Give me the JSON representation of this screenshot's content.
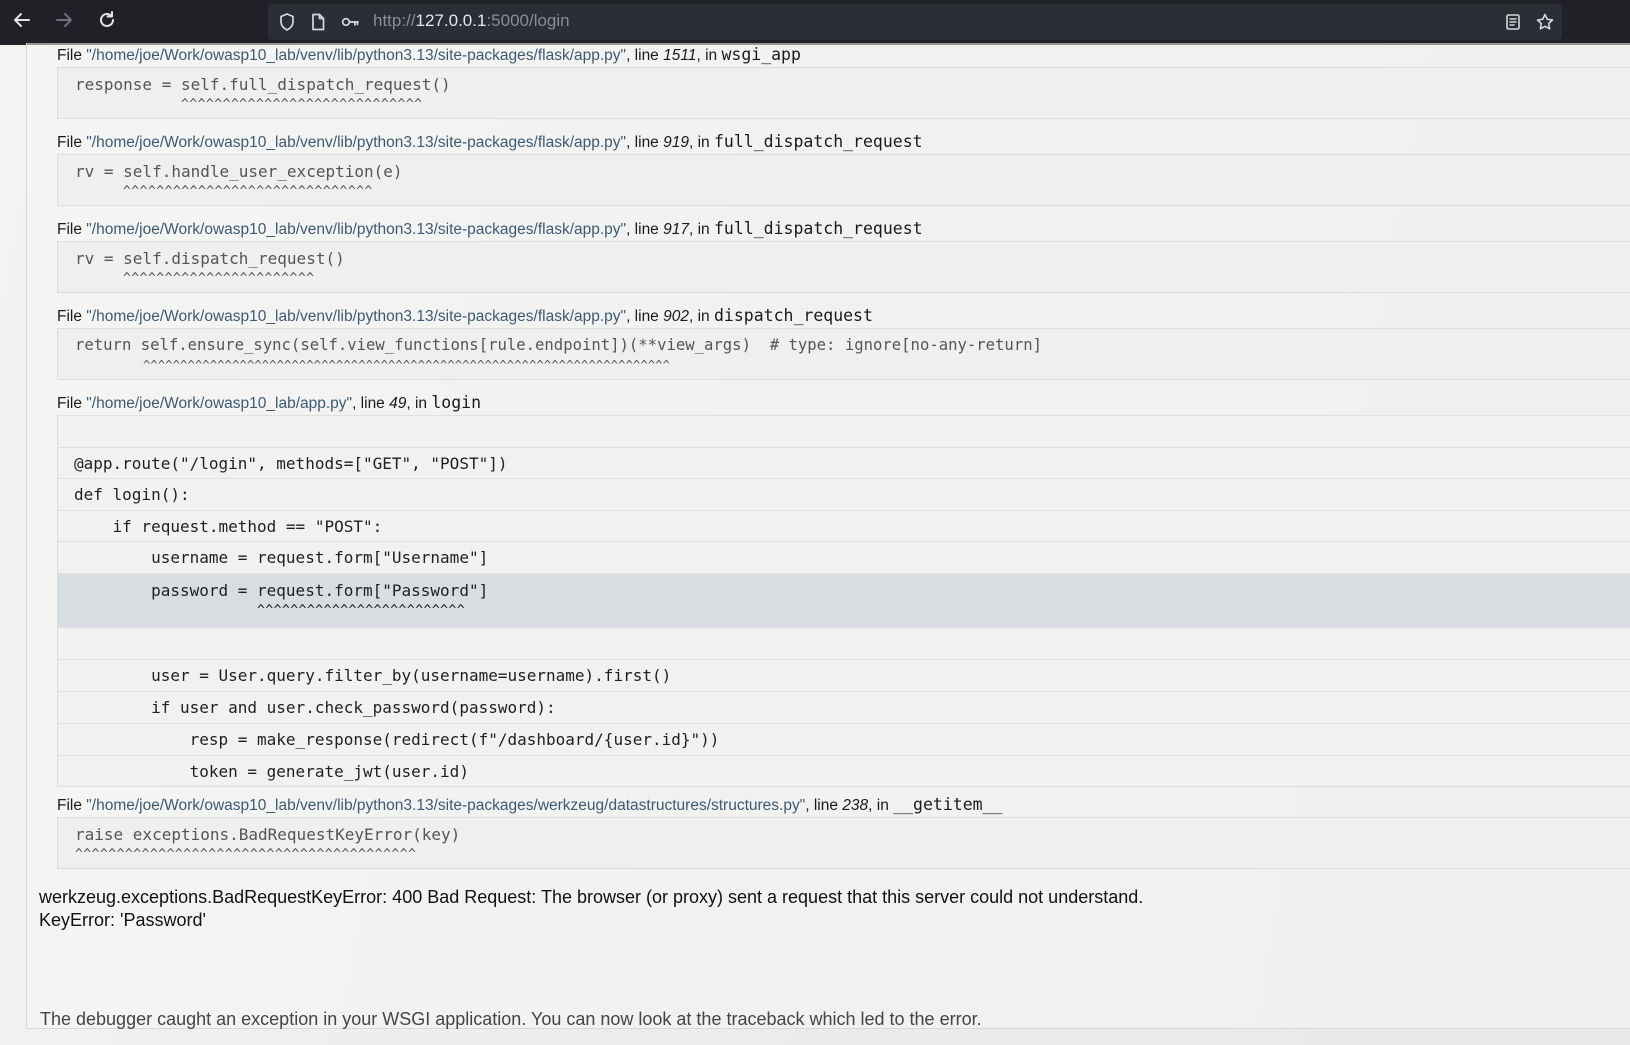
{
  "browser": {
    "url_prefix": "http://",
    "url_host": "127.0.0.1",
    "url_suffix": ":5000/login",
    "icons": [
      "back-arrow-icon",
      "forward-arrow-icon",
      "reload-icon",
      "shield-icon",
      "page-icon",
      "key-icon",
      "reader-view-icon",
      "bookmark-star-icon"
    ]
  },
  "frames": [
    {
      "file_prefix": "File ",
      "path": "\"/home/joe/Work/owasp10_lab/venv/lib/python3.13/site-packages/flask/app.py\"",
      "line_label": ", line ",
      "line": "1511",
      "in_label": ", in ",
      "function": "wsgi_app",
      "code": "response = self.full_dispatch_request()",
      "carets": "^^^^^^^^^^^^^^^^^^^^^^^^^^^^^"
    },
    {
      "file_prefix": "File ",
      "path": "\"/home/joe/Work/owasp10_lab/venv/lib/python3.13/site-packages/flask/app.py\"",
      "line_label": ", line ",
      "line": "919",
      "in_label": ", in ",
      "function": "full_dispatch_request",
      "code": "rv = self.handle_user_exception(e)",
      "carets": "^^^^^^^^^^^^^^^^^^^^^^^^^^^^^^"
    },
    {
      "file_prefix": "File ",
      "path": "\"/home/joe/Work/owasp10_lab/venv/lib/python3.13/site-packages/flask/app.py\"",
      "line_label": ", line ",
      "line": "917",
      "in_label": ", in ",
      "function": "full_dispatch_request",
      "code": "rv = self.dispatch_request()",
      "carets": "^^^^^^^^^^^^^^^^^^^^^^^"
    },
    {
      "file_prefix": "File ",
      "path": "\"/home/joe/Work/owasp10_lab/venv/lib/python3.13/site-packages/flask/app.py\"",
      "line_label": ", line ",
      "line": "902",
      "in_label": ", in ",
      "function": "dispatch_request",
      "code": "return self.ensure_sync(self.view_functions[rule.endpoint])(**view_args)  # type: ignore[no-any-return]",
      "carets": "^^^^^^^^^^^^^^^^^^^^^^^^^^^^^^^^^^^^^^^^^^^^^^^^^^^^^^^^^^^^^^^^^^^^^^^"
    },
    {
      "file_prefix": "File ",
      "path": "\"/home/joe/Work/owasp10_lab/app.py\"",
      "line_label": ", line ",
      "line": "49",
      "in_label": ", in ",
      "function": "login",
      "source_lines": [
        "",
        "@app.route(\"/login\", methods=[\"GET\", \"POST\"])",
        "def login():",
        "    if request.method == \"POST\":",
        "        username = request.form[\"Username\"]",
        "        password = request.form[\"Password\"]",
        "",
        "        user = User.query.filter_by(username=username).first()",
        "        if user and user.check_password(password):",
        "            resp = make_response(redirect(f\"/dashboard/{user.id}\"))",
        "            token = generate_jwt(user.id)"
      ],
      "current_carets": "^^^^^^^^^^^^^^^^^^^^^^^^^"
    },
    {
      "file_prefix": "File ",
      "path": "\"/home/joe/Work/owasp10_lab/venv/lib/python3.13/site-packages/werkzeug/datastructures/structures.py\"",
      "line_label": ", line ",
      "line": "238",
      "in_label": ", in ",
      "function": "__getitem__",
      "code": "raise exceptions.BadRequestKeyError(key)",
      "carets": "^^^^^^^^^^^^^^^^^^^^^^^^^^^^^^^^^^^^^^^^^"
    }
  ],
  "error": {
    "message": "werkzeug.exceptions.BadRequestKeyError: 400 Bad Request: The browser (or proxy) sent a request that this server could not understand.",
    "key_error": "KeyError: 'Password'"
  },
  "explanation": "The debugger caught an exception in your WSGI application. You can now look at the traceback which led to the error."
}
